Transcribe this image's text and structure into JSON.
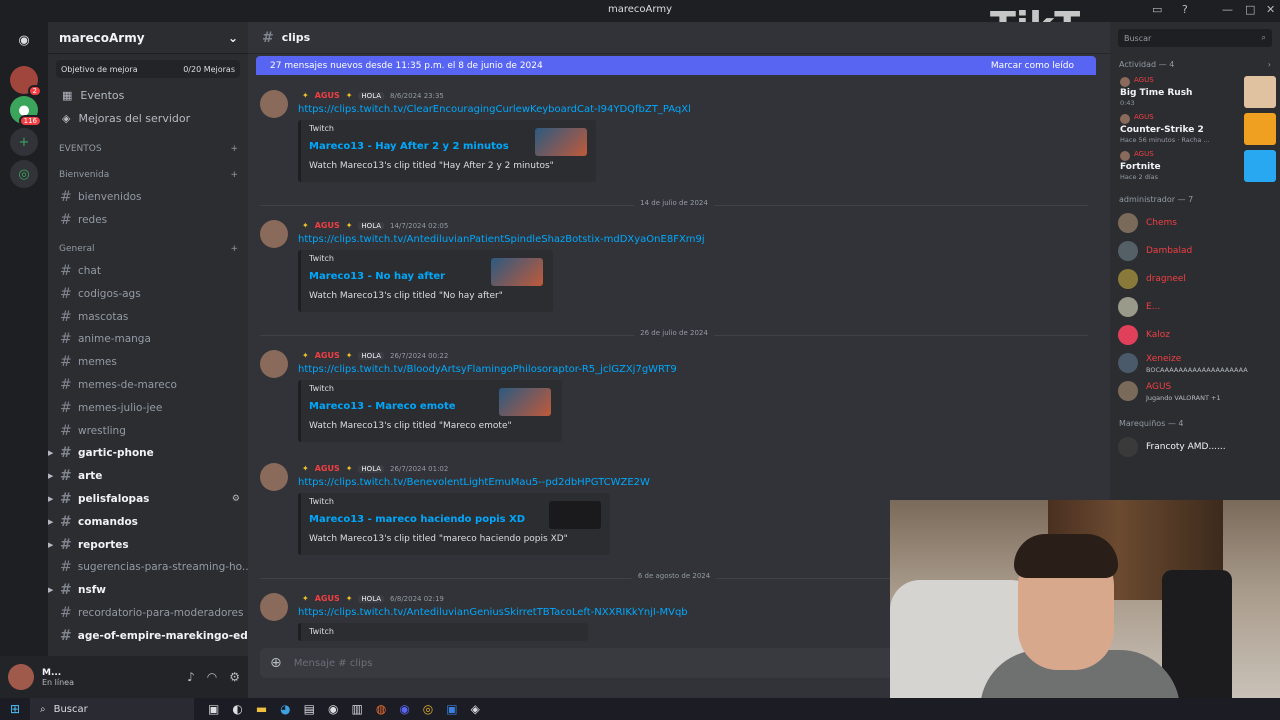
{
  "window": {
    "title": "marecoArmy"
  },
  "server": {
    "name": "marecoArmy",
    "goal_label": "Objetivo de mejora",
    "goal_progress": "0/20 Mejoras",
    "menu": [
      "Eventos",
      "Mejoras del servidor"
    ],
    "events_label": "EVENTOS",
    "categories": [
      {
        "name": "Bienvenida",
        "channels": [
          "bienvenidos",
          "redes"
        ]
      },
      {
        "name": "General",
        "channels": [
          "chat",
          "codigos-ags",
          "mascotas",
          "anime-manga",
          "memes",
          "memes-de-mareco",
          "memes-julio-jee",
          "wrestling",
          "gartic-phone",
          "arte",
          "pelisfalopas",
          "comandos",
          "reportes",
          "sugerencias-para-streaming-ho...",
          "nsfw",
          "recordatorio-para-moderadores",
          "age-of-empire-marekingo-edition"
        ]
      }
    ]
  },
  "user_panel": {
    "name": "M...",
    "status": "En línea"
  },
  "channel": {
    "name": "clips",
    "composer_placeholder": "Mensaje # clips"
  },
  "new_messages_bar": {
    "text": "27 mensajes nuevos desde 11:35 p.m. el 8 de junio de 2024",
    "action": "Marcar como leído"
  },
  "messages": [
    {
      "user": "AGUS",
      "tag": "HOLA",
      "time": "8/6/2024 23:35",
      "link": "https://clips.twitch.tv/ClearEncouragingCurlewKeyboardCat-I94YDQfbZT_PAqXl",
      "provider": "Twitch",
      "title": "Mareco13 - Hay After 2 y 2 minutos",
      "desc": "Watch Mareco13's clip titled \"Hay After 2 y 2 minutos\""
    },
    {
      "user": "AGUS",
      "tag": "HOLA",
      "time": "14/7/2024 02:05",
      "link": "https://clips.twitch.tv/AntediluvianPatientSpindleShazBotstix-mdDXyaOnE8FXm9j",
      "provider": "Twitch",
      "title": "Mareco13 - No hay after",
      "desc": "Watch Mareco13's clip titled \"No hay after\""
    },
    {
      "user": "AGUS",
      "tag": "HOLA",
      "time": "26/7/2024 00:22",
      "link": "https://clips.twitch.tv/BloodyArtsyFlamingoPhilosoraptor-R5_jclGZXj7gWRT9",
      "provider": "Twitch",
      "title": "Mareco13 - Mareco emote",
      "desc": "Watch Mareco13's clip titled \"Mareco emote\""
    },
    {
      "user": "AGUS",
      "tag": "HOLA",
      "time": "26/7/2024 01:02",
      "link": "https://clips.twitch.tv/BenevolentLightEmuMau5--pd2dbHPGTCWZE2W",
      "provider": "Twitch",
      "title": "Mareco13 - mareco haciendo popis XD",
      "desc": "Watch Mareco13's clip titled \"mareco haciendo popis XD\""
    },
    {
      "user": "AGUS",
      "tag": "HOLA",
      "time": "6/8/2024 02:19",
      "link": "https://clips.twitch.tv/AntediluvianGeniusSkirretTBTacoLeft-NXXRIKkYnjI-MVqb",
      "provider": "Twitch"
    }
  ],
  "date_separators": [
    "14 de julio de 2024",
    "26 de julio de 2024",
    "6 de agosto de 2024"
  ],
  "members": {
    "search_placeholder": "Buscar",
    "activity_title": "Actividad — 4",
    "activities": [
      {
        "user": "AGUS",
        "game": "Big Time Rush",
        "sub": "0:43",
        "color": "#e0c2a0"
      },
      {
        "user": "AGUS",
        "game": "Counter-Strike 2",
        "sub": "Hace 56 minutos · Racha ...",
        "color": "#f0a020"
      },
      {
        "user": "AGUS",
        "game": "Fortnite",
        "sub": "Hace 2 días",
        "color": "#27a8f0"
      }
    ],
    "admin_title": "administrador — 7",
    "admins": [
      {
        "name": "Chems",
        "sub": ""
      },
      {
        "name": "Dambalad",
        "sub": ""
      },
      {
        "name": "dragneel",
        "sub": ""
      },
      {
        "name": "E...",
        "sub": ""
      },
      {
        "name": "Kaloz",
        "sub": ""
      },
      {
        "name": "Xeneize",
        "sub": "BOCAAAAAAAAAAAAAAAAAAA"
      },
      {
        "name": "AGUS",
        "sub": "Jugando VALORANT +1"
      }
    ],
    "marequinos_title": "Marequiños — 4",
    "marequinos": [
      {
        "name": "Francoty AMD......"
      }
    ]
  },
  "taskbar": {
    "search": "Buscar"
  },
  "overlay": {
    "tiktok": "TikT"
  }
}
